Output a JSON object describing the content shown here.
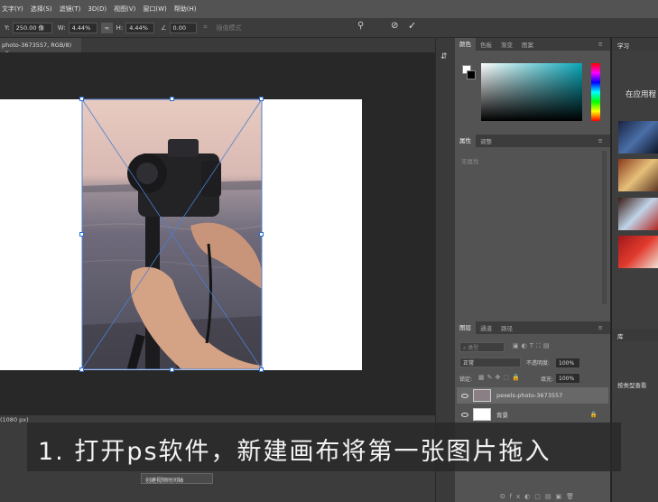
{
  "menubar": {
    "items": [
      "文字(Y)",
      "选择(S)",
      "滤镜(T)",
      "3D(D)",
      "视图(V)",
      "窗口(W)",
      "帮助(H)"
    ]
  },
  "options": {
    "y_label": "Y:",
    "y_value": "250.00 像",
    "w_label": "W:",
    "w_value": "4.44%",
    "link_glyph": "∞",
    "h_label": "H:",
    "h_value": "4.44%",
    "angle_value": "0.00",
    "interp_label": "插值模式"
  },
  "document": {
    "tab_title": "photo-3673557, RGB/8)"
  },
  "panels": {
    "color_tabs": [
      "颜色",
      "色板",
      "渐变",
      "图案"
    ],
    "props_tabs": [
      "属性",
      "调整"
    ],
    "props_empty": "无属性",
    "layers_tabs": [
      "图层",
      "通道",
      "路径"
    ],
    "layers": {
      "kind_placeholder": "类型",
      "blend_mode": "正常",
      "opacity_label": "不透明度:",
      "opacity_value": "100%",
      "lock_label": "锁定:",
      "fill_label": "填充:",
      "fill_value": "100%",
      "items": [
        {
          "name": "pexels-photo-3673557"
        },
        {
          "name": "背景"
        }
      ]
    }
  },
  "learn": {
    "tab": "学习",
    "heading": "在应用程",
    "library_tab": "库",
    "sort_label": "按类型查看"
  },
  "bottom": {
    "status_text": "(1080 px)",
    "timeline_button": "创建视频时间轴"
  },
  "caption": {
    "text": "1. 打开ps软件，新建画布将第一张图片拖入"
  },
  "colors": {
    "accent": "#2f6fce",
    "panel_bg": "#535353"
  }
}
